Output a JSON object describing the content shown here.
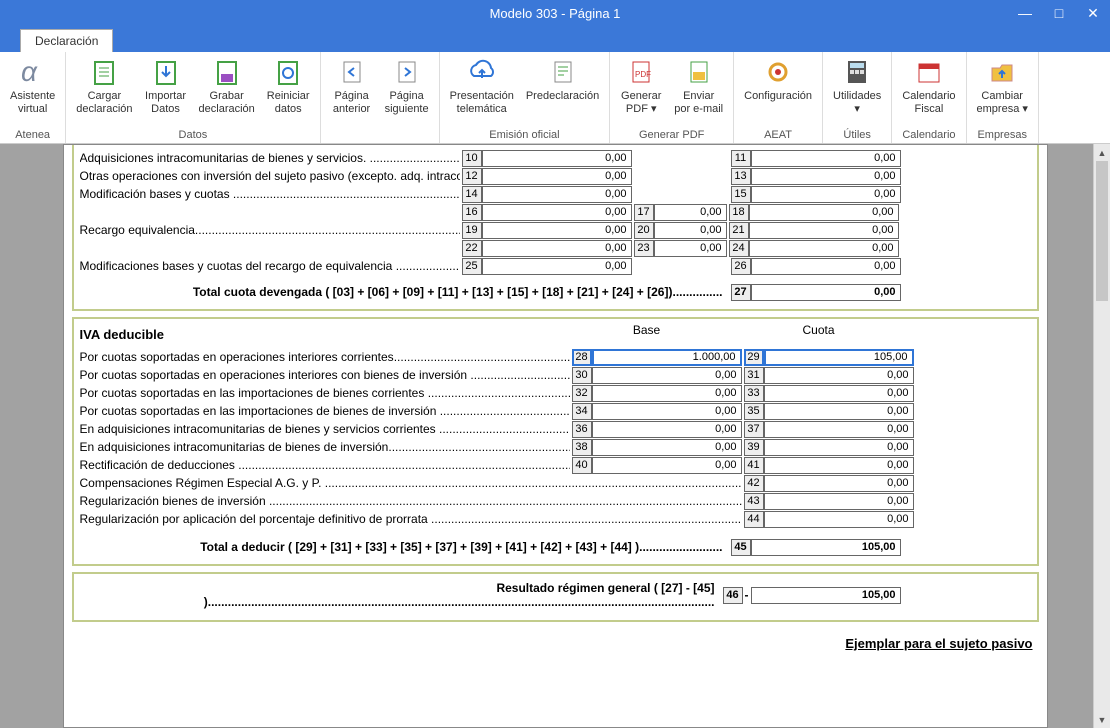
{
  "titlebar": {
    "title": "Modelo 303 - Página 1"
  },
  "tab": {
    "label": "Declaración"
  },
  "ribbon": {
    "groups": [
      {
        "label": "Atenea",
        "buttons": [
          {
            "l1": "Asistente",
            "l2": "virtual"
          }
        ]
      },
      {
        "label": "Datos",
        "buttons": [
          {
            "l1": "Cargar",
            "l2": "declaración"
          },
          {
            "l1": "Importar",
            "l2": "Datos"
          },
          {
            "l1": "Grabar",
            "l2": "declaración"
          },
          {
            "l1": "Reiniciar",
            "l2": "datos"
          }
        ]
      },
      {
        "label": "",
        "buttons": [
          {
            "l1": "Página",
            "l2": "anterior"
          },
          {
            "l1": "Página",
            "l2": "siguiente"
          }
        ]
      },
      {
        "label": "Emisión oficial",
        "buttons": [
          {
            "l1": "Presentación",
            "l2": "telemática"
          },
          {
            "l1": "Predeclaración",
            "l2": ""
          }
        ]
      },
      {
        "label": "Generar PDF",
        "buttons": [
          {
            "l1": "Generar",
            "l2": "PDF ▾"
          },
          {
            "l1": "Enviar",
            "l2": "por e-mail"
          }
        ]
      },
      {
        "label": "AEAT",
        "buttons": [
          {
            "l1": "Configuración",
            "l2": ""
          }
        ]
      },
      {
        "label": "Útiles",
        "buttons": [
          {
            "l1": "Utilidades",
            "l2": "▾"
          }
        ]
      },
      {
        "label": "Calendario",
        "buttons": [
          {
            "l1": "Calendario",
            "l2": "Fiscal"
          }
        ]
      },
      {
        "label": "Empresas",
        "buttons": [
          {
            "l1": "Cambiar",
            "l2": "empresa ▾"
          }
        ]
      }
    ]
  },
  "top": {
    "r1": {
      "t": "Adquisiciones intracomunitarias de bienes y servicios. ",
      "n1": "10",
      "v1": "0,00",
      "n2": "11",
      "v2": "0,00"
    },
    "r2": {
      "t": "Otras operaciones con inversión del sujeto pasivo (excepto. adq. intracom) ",
      "n1": "12",
      "v1": "0,00",
      "n2": "13",
      "v2": "0,00"
    },
    "r3": {
      "t": "Modificación bases y cuotas ",
      "n1": "14",
      "v1": "0,00",
      "n2": "15",
      "v2": "0,00"
    },
    "re_label": "Recargo equivalencia",
    "re": [
      {
        "n1": "16",
        "b": "0,00",
        "n2": "17",
        "p": "0,00",
        "n3": "18",
        "c": "0,00"
      },
      {
        "n1": "19",
        "b": "0,00",
        "n2": "20",
        "p": "0,00",
        "n3": "21",
        "c": "0,00"
      },
      {
        "n1": "22",
        "b": "0,00",
        "n2": "23",
        "p": "0,00",
        "n3": "24",
        "c": "0,00"
      }
    ],
    "r4": {
      "t": "Modificaciones bases y cuotas del recargo de equivalencia ",
      "n1": "25",
      "v1": "0,00",
      "n2": "26",
      "v2": "0,00"
    },
    "total": {
      "t": "Total cuota devengada ( [03] + [06] + [09] + [11] + [13] + [15] + [18] + [21] + [24] + [26])",
      "n": "27",
      "v": "0,00"
    }
  },
  "ded": {
    "title": "IVA deducible",
    "hbase": "Base",
    "hcuota": "Cuota",
    "rows": [
      {
        "t": "Por cuotas soportadas en operaciones interiores corrientes",
        "n1": "28",
        "b": "1.000,00",
        "n2": "29",
        "c": "105,00",
        "hl": true
      },
      {
        "t": "Por cuotas soportadas en operaciones interiores con bienes de inversión ",
        "n1": "30",
        "b": "0,00",
        "n2": "31",
        "c": "0,00"
      },
      {
        "t": "Por cuotas soportadas en las importaciones de bienes corrientes ",
        "n1": "32",
        "b": "0,00",
        "n2": "33",
        "c": "0,00"
      },
      {
        "t": "Por cuotas soportadas en las importaciones de bienes de inversión ",
        "n1": "34",
        "b": "0,00",
        "n2": "35",
        "c": "0,00"
      },
      {
        "t": "En adquisiciones intracomunitarias de bienes y servicios corrientes ",
        "n1": "36",
        "b": "0,00",
        "n2": "37",
        "c": "0,00"
      },
      {
        "t": "En adquisiciones intracomunitarias de bienes de inversión",
        "n1": "38",
        "b": "0,00",
        "n2": "39",
        "c": "0,00"
      },
      {
        "t": "Rectificación de deducciones ",
        "n1": "40",
        "b": "0,00",
        "n2": "41",
        "c": "0,00"
      }
    ],
    "short": [
      {
        "t": "Compensaciones Régimen Especial A.G. y P. ",
        "n": "42",
        "c": "0,00"
      },
      {
        "t": "Regularización bienes de inversión ",
        "n": "43",
        "c": "0,00"
      },
      {
        "t": "Regularización por aplicación del porcentaje definitivo de prorrata ",
        "n": "44",
        "c": "0,00"
      }
    ],
    "total": {
      "t": "Total a deducir ( [29] + [31] + [33] + [35] + [37] + [39] + [41] + [42] + [43] + [44] )",
      "n": "45",
      "v": "105,00"
    }
  },
  "res": {
    "t": "Resultado régimen general ( [27] - [45] )",
    "n": "46",
    "v": "105,00"
  },
  "footer": "Ejemplar para el sujeto pasivo"
}
